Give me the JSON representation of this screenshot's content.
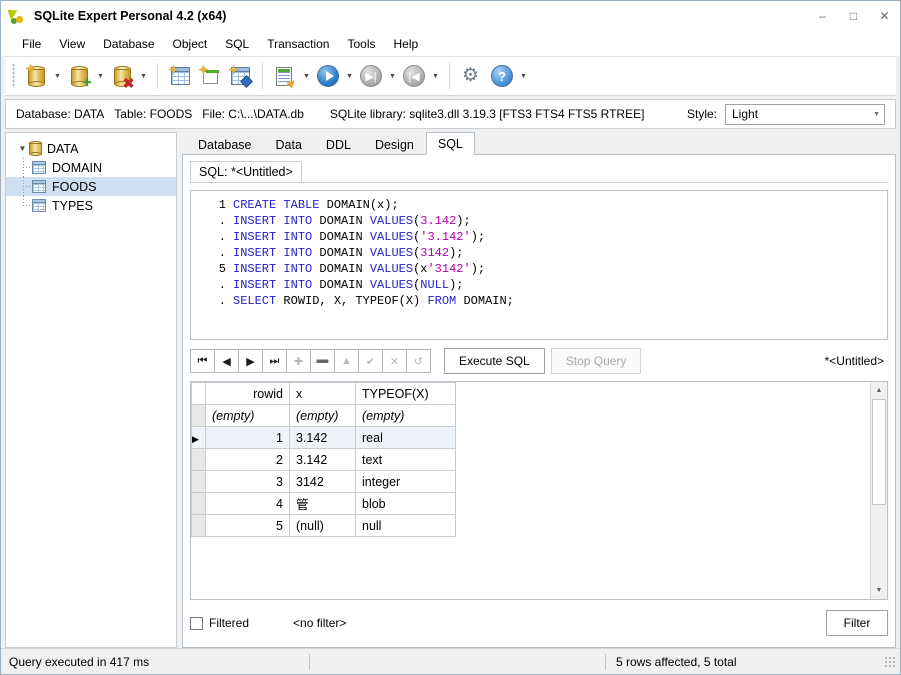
{
  "window": {
    "title": "SQLite Expert Personal 4.2 (x64)",
    "app_icon": "sqlite-expert-icon",
    "controls": {
      "minimize": "–",
      "maximize": "□",
      "close": "✕"
    }
  },
  "menubar": {
    "items": [
      "File",
      "View",
      "Database",
      "Object",
      "SQL",
      "Transaction",
      "Tools",
      "Help"
    ]
  },
  "toolbar": {
    "buttons": [
      {
        "name": "open-database",
        "icon": "database-open-icon",
        "dropdown": true
      },
      {
        "name": "new-database",
        "icon": "database-add-icon",
        "dropdown": true
      },
      {
        "name": "delete-database",
        "icon": "database-delete-icon",
        "dropdown": true
      },
      {
        "name": "new-table",
        "icon": "table-new-icon",
        "dropdown": false
      },
      {
        "name": "new-view",
        "icon": "view-new-icon",
        "dropdown": false
      },
      {
        "name": "new-index",
        "icon": "index-new-icon",
        "dropdown": false
      },
      {
        "name": "sql-editor",
        "icon": "sql-editor-icon",
        "dropdown": true
      },
      {
        "name": "execute",
        "icon": "play-icon",
        "dropdown": true
      },
      {
        "name": "step-forward",
        "icon": "step-forward-icon",
        "dropdown": true
      },
      {
        "name": "step-back",
        "icon": "step-back-icon",
        "dropdown": true
      },
      {
        "name": "options",
        "icon": "gear-icon",
        "dropdown": false
      },
      {
        "name": "help",
        "icon": "help-icon",
        "dropdown": true
      }
    ]
  },
  "infobar": {
    "database": "Database: DATA",
    "table": "Table: FOODS",
    "file": "File: C:\\...\\DATA.db",
    "library": "SQLite library: sqlite3.dll 3.19.3 [FTS3 FTS4 FTS5 RTREE]",
    "style_label": "Style:",
    "style_value": "Light"
  },
  "tree": {
    "root": {
      "label": "DATA",
      "icon": "database-icon",
      "expanded": true
    },
    "children": [
      {
        "label": "DOMAIN",
        "icon": "table-icon",
        "selected": false
      },
      {
        "label": "FOODS",
        "icon": "table-icon",
        "selected": true
      },
      {
        "label": "TYPES",
        "icon": "table-icon",
        "selected": false
      }
    ]
  },
  "tabs": {
    "items": [
      "Database",
      "Data",
      "DDL",
      "Design",
      "SQL"
    ],
    "active": "SQL",
    "subtab": "SQL: *<Untitled>"
  },
  "editor": {
    "lines": [
      {
        "gutter": "1",
        "tokens": [
          {
            "t": "CREATE",
            "c": "kw"
          },
          {
            "t": " ",
            "c": "pl"
          },
          {
            "t": "TABLE",
            "c": "kw"
          },
          {
            "t": " DOMAIN(x);",
            "c": "pl"
          }
        ]
      },
      {
        "gutter": ".",
        "tokens": [
          {
            "t": "INSERT",
            "c": "kw"
          },
          {
            "t": " ",
            "c": "pl"
          },
          {
            "t": "INTO",
            "c": "kw"
          },
          {
            "t": " DOMAIN ",
            "c": "pl"
          },
          {
            "t": "VALUES",
            "c": "kw"
          },
          {
            "t": "(",
            "c": "pl"
          },
          {
            "t": "3.142",
            "c": "lit"
          },
          {
            "t": ");",
            "c": "pl"
          }
        ]
      },
      {
        "gutter": ".",
        "tokens": [
          {
            "t": "INSERT",
            "c": "kw"
          },
          {
            "t": " ",
            "c": "pl"
          },
          {
            "t": "INTO",
            "c": "kw"
          },
          {
            "t": " DOMAIN ",
            "c": "pl"
          },
          {
            "t": "VALUES",
            "c": "kw"
          },
          {
            "t": "(",
            "c": "pl"
          },
          {
            "t": "'3.142'",
            "c": "lit"
          },
          {
            "t": ");",
            "c": "pl"
          }
        ]
      },
      {
        "gutter": ".",
        "tokens": [
          {
            "t": "INSERT",
            "c": "kw"
          },
          {
            "t": " ",
            "c": "pl"
          },
          {
            "t": "INTO",
            "c": "kw"
          },
          {
            "t": " DOMAIN ",
            "c": "pl"
          },
          {
            "t": "VALUES",
            "c": "kw"
          },
          {
            "t": "(",
            "c": "pl"
          },
          {
            "t": "3142",
            "c": "lit"
          },
          {
            "t": ");",
            "c": "pl"
          }
        ]
      },
      {
        "gutter": "5",
        "tokens": [
          {
            "t": "INSERT",
            "c": "kw"
          },
          {
            "t": " ",
            "c": "pl"
          },
          {
            "t": "INTO",
            "c": "kw"
          },
          {
            "t": " DOMAIN ",
            "c": "pl"
          },
          {
            "t": "VALUES",
            "c": "kw"
          },
          {
            "t": "(x",
            "c": "pl"
          },
          {
            "t": "'3142'",
            "c": "lit"
          },
          {
            "t": ");",
            "c": "pl"
          }
        ]
      },
      {
        "gutter": ".",
        "tokens": [
          {
            "t": "INSERT",
            "c": "kw"
          },
          {
            "t": " ",
            "c": "pl"
          },
          {
            "t": "INTO",
            "c": "kw"
          },
          {
            "t": " DOMAIN ",
            "c": "pl"
          },
          {
            "t": "VALUES",
            "c": "kw"
          },
          {
            "t": "(",
            "c": "pl"
          },
          {
            "t": "NULL",
            "c": "kw"
          },
          {
            "t": ");",
            "c": "pl"
          }
        ]
      },
      {
        "gutter": ".",
        "tokens": [
          {
            "t": "SELECT",
            "c": "kw"
          },
          {
            "t": " ROWID, X, TYPEOF(X) ",
            "c": "pl"
          },
          {
            "t": "FROM",
            "c": "kw"
          },
          {
            "t": " DOMAIN;",
            "c": "pl"
          }
        ]
      }
    ]
  },
  "grid_toolbar": {
    "nav": [
      {
        "name": "first-record",
        "glyph": "⏮",
        "disabled": false
      },
      {
        "name": "prev-record",
        "glyph": "◀",
        "disabled": false
      },
      {
        "name": "next-record",
        "glyph": "▶",
        "disabled": false
      },
      {
        "name": "last-record",
        "glyph": "⏭",
        "disabled": false
      },
      {
        "name": "insert-record",
        "glyph": "✚",
        "disabled": true
      },
      {
        "name": "delete-record",
        "glyph": "➖",
        "disabled": true
      },
      {
        "name": "edit-record",
        "glyph": "▲",
        "disabled": true
      },
      {
        "name": "post-edit",
        "glyph": "✔",
        "disabled": true
      },
      {
        "name": "cancel-edit",
        "glyph": "✕",
        "disabled": true
      },
      {
        "name": "refresh",
        "glyph": "↺",
        "disabled": true
      }
    ],
    "execute_label": "Execute SQL",
    "stop_label": "Stop Query",
    "untitled_label": "*<Untitled>"
  },
  "results": {
    "columns": [
      "rowid",
      "x",
      "TYPEOF(X)"
    ],
    "filter_row": [
      "(empty)",
      "(empty)",
      "(empty)"
    ],
    "rows": [
      {
        "current": true,
        "cells": [
          "1",
          "3.142",
          "real"
        ]
      },
      {
        "current": false,
        "cells": [
          "2",
          "3.142",
          "text"
        ]
      },
      {
        "current": false,
        "cells": [
          "3",
          "3142",
          "integer"
        ]
      },
      {
        "current": false,
        "cells": [
          "4",
          "管",
          "blob"
        ]
      },
      {
        "current": false,
        "cells": [
          "5",
          "(null)",
          "null"
        ]
      }
    ]
  },
  "filterbar": {
    "checkbox_label": "Filtered",
    "checked": false,
    "filter_text": "<no filter>",
    "filter_button": "Filter"
  },
  "statusbar": {
    "left": "Query executed in 417 ms",
    "right": "5 rows affected, 5 total"
  }
}
